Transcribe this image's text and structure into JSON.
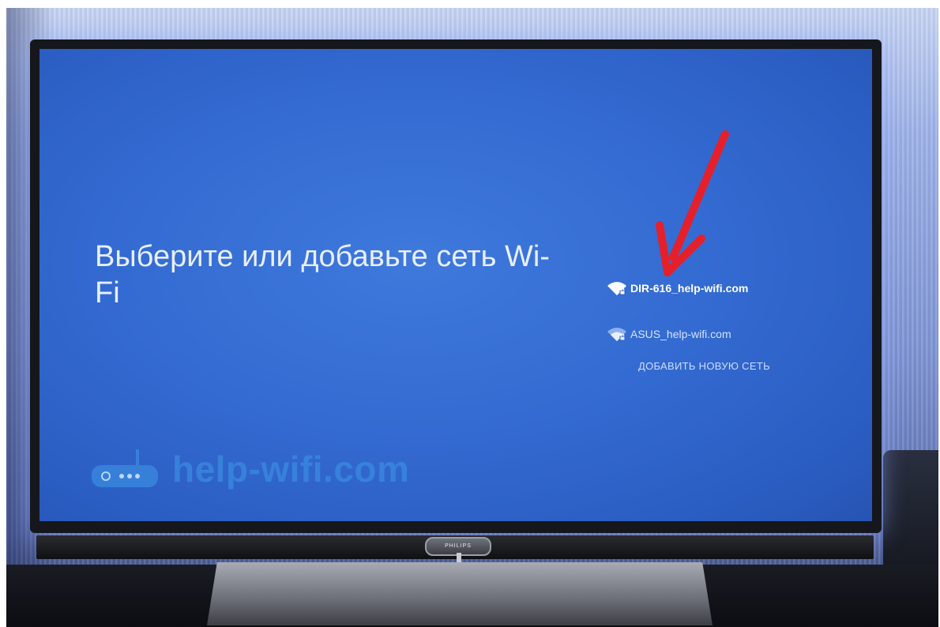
{
  "screen": {
    "title": "Выберите или добавьте сеть Wi-Fi"
  },
  "networks": [
    {
      "name": "DIR-616_help-wifi.com",
      "icon": "wifi-lock-icon",
      "selected": true
    },
    {
      "name": "ASUS_help-wifi.com",
      "icon": "wifi-lock-icon",
      "selected": false
    }
  ],
  "add_network_label": "ДОБАВИТЬ НОВУЮ СЕТЬ",
  "watermark": {
    "text": "help-wifi.com",
    "icon": "router-icon"
  },
  "tv": {
    "brand": "PHILIPS"
  },
  "colors": {
    "screen_bg": "#346bd2",
    "arrow": "#e4202b",
    "watermark": "#3a8be0"
  }
}
